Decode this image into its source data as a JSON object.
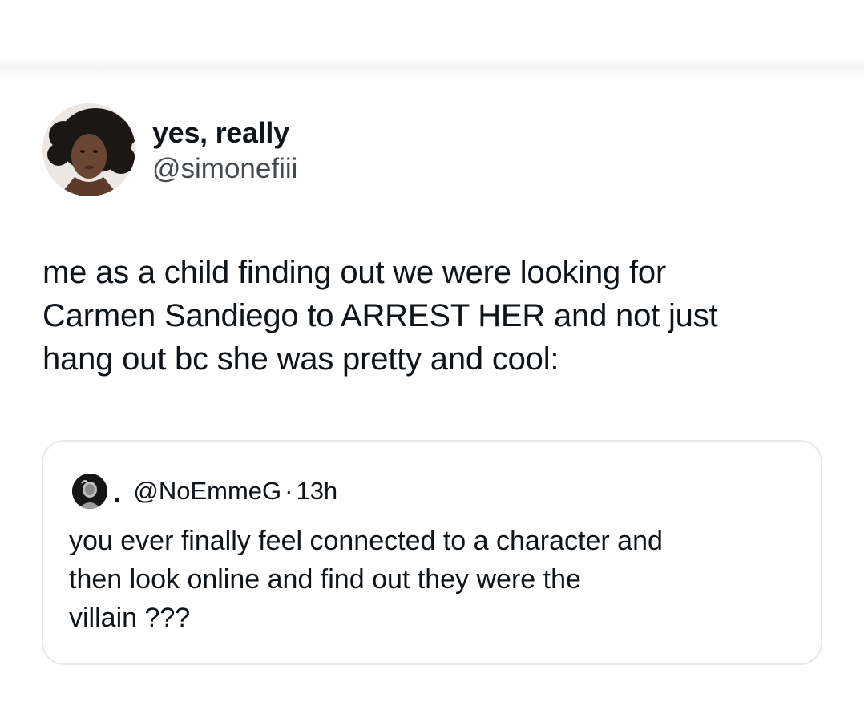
{
  "tweet": {
    "display_name": "yes, really",
    "handle": "@simonefiii",
    "text": "me as a child finding out we were looking for\nCarmen Sandiego to ARREST HER and not just\nhang out bc she was pretty and cool:",
    "avatar_icon": "profile-photo"
  },
  "quote": {
    "avatar_icon": "profile-photo-dark",
    "display_name": ".",
    "handle": "@NoEmmeG",
    "separator": "·",
    "time": "13h",
    "text": "you ever finally  feel connected to a character and\nthen look online and find out they were the\nvillain ???"
  },
  "colors": {
    "text": "#0f1419",
    "secondary_text": "#454a4e",
    "card_border": "#e6e8ea",
    "background": "#ffffff"
  }
}
